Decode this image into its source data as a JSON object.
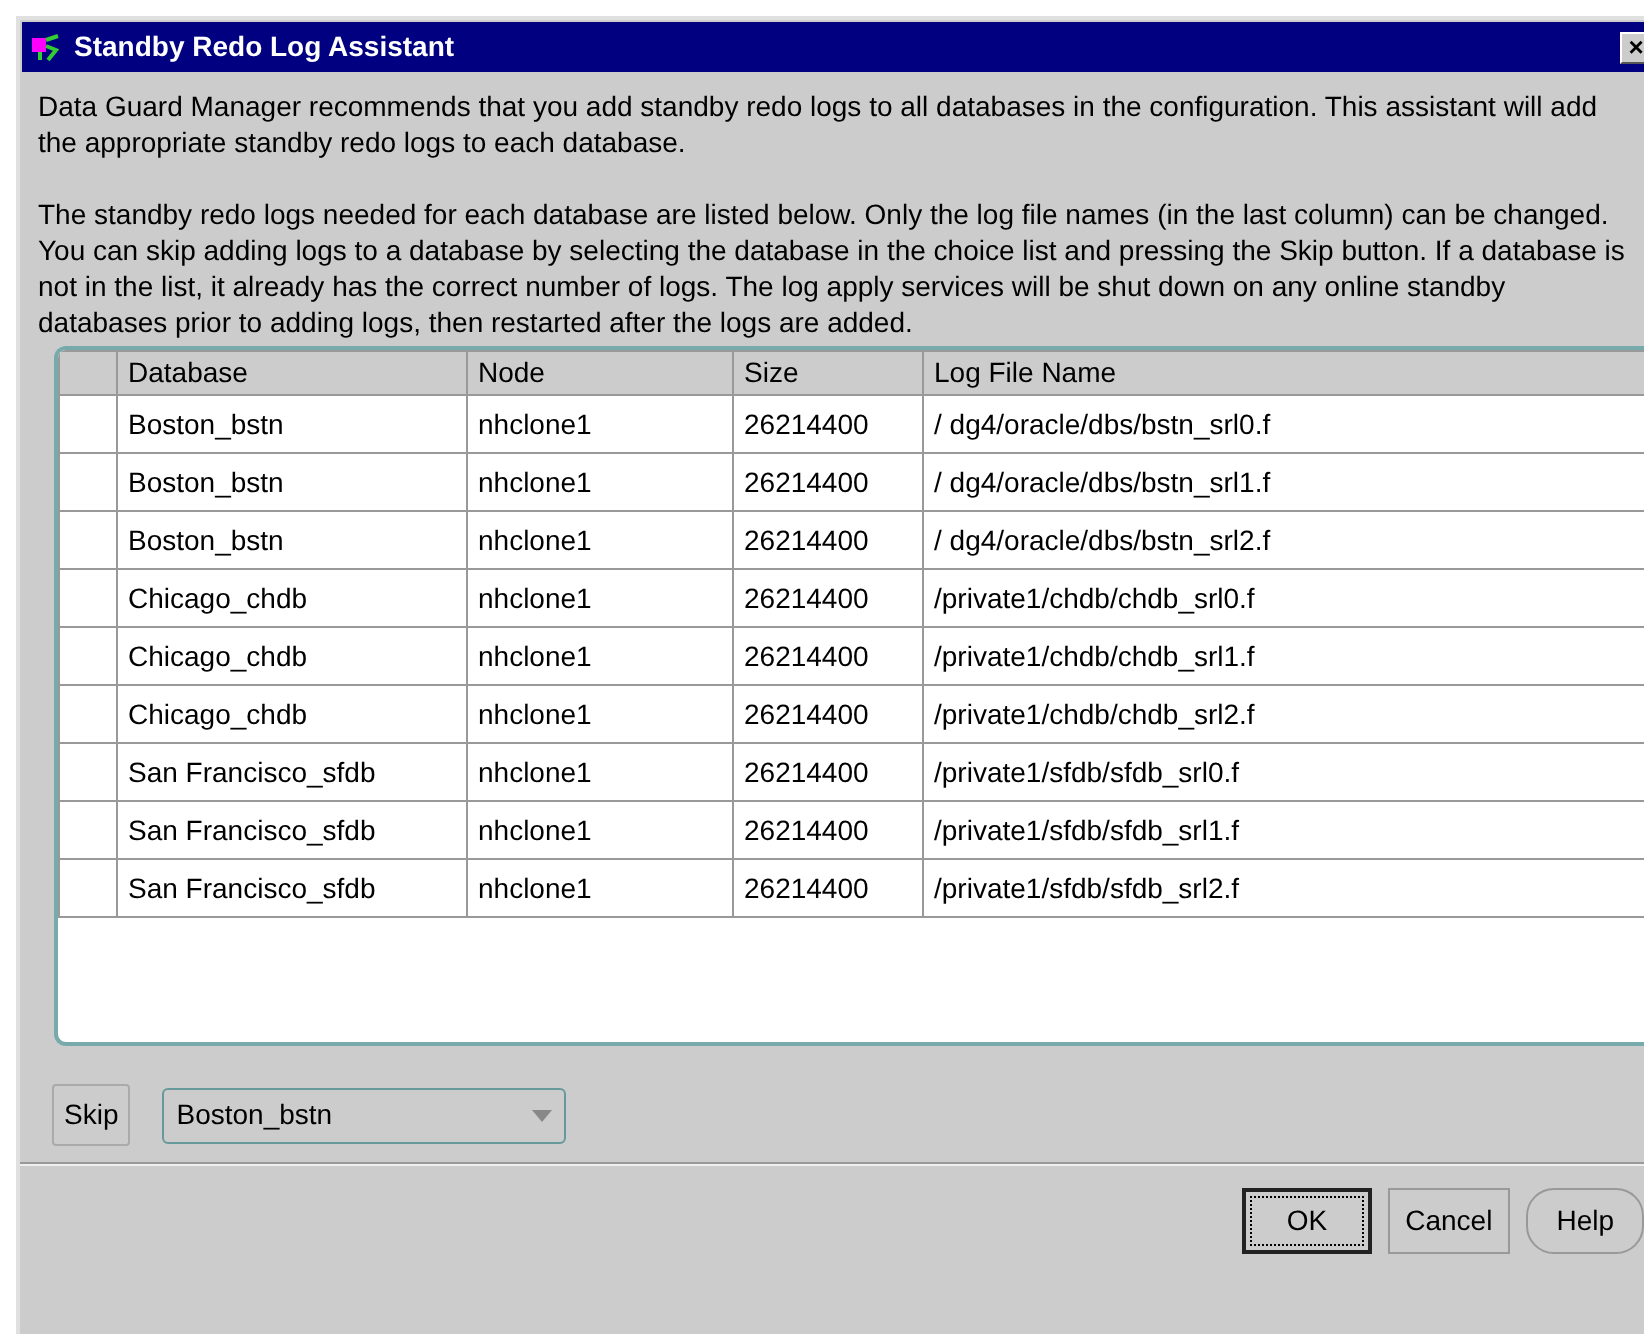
{
  "window": {
    "title": "Standby Redo Log Assistant",
    "close": "×"
  },
  "paragraphs": [
    "Data Guard Manager recommends that you add standby redo logs to all databases in the configuration. This assistant will add the appropriate standby redo logs to each database.",
    "The standby redo logs needed for each database are listed below. Only the log file names (in the last column) can be changed. You can skip adding logs to a database by selecting the database in the choice list and pressing the Skip button. If a database is not in the list, it already has the correct number of logs. The log apply services will be shut down on any online standby databases prior to adding logs, then restarted after the logs are added."
  ],
  "table": {
    "columns": [
      "Database",
      "Node",
      "Size",
      "Log File Name"
    ],
    "rows": [
      [
        "Boston_bstn",
        "nhclone1",
        "26214400",
        "/ dg4/oracle/dbs/bstn_srl0.f"
      ],
      [
        "Boston_bstn",
        "nhclone1",
        "26214400",
        "/ dg4/oracle/dbs/bstn_srl1.f"
      ],
      [
        "Boston_bstn",
        "nhclone1",
        "26214400",
        "/ dg4/oracle/dbs/bstn_srl2.f"
      ],
      [
        "Chicago_chdb",
        "nhclone1",
        "26214400",
        "/private1/chdb/chdb_srl0.f"
      ],
      [
        "Chicago_chdb",
        "nhclone1",
        "26214400",
        "/private1/chdb/chdb_srl1.f"
      ],
      [
        "Chicago_chdb",
        "nhclone1",
        "26214400",
        "/private1/chdb/chdb_srl2.f"
      ],
      [
        "San Francisco_sfdb",
        "nhclone1",
        "26214400",
        "/private1/sfdb/sfdb_srl0.f"
      ],
      [
        "San Francisco_sfdb",
        "nhclone1",
        "26214400",
        "/private1/sfdb/sfdb_srl1.f"
      ],
      [
        "San Francisco_sfdb",
        "nhclone1",
        "26214400",
        "/private1/sfdb/sfdb_srl2.f"
      ]
    ]
  },
  "skip_button": "Skip",
  "database_choice": {
    "value": "Boston_bstn"
  },
  "buttons": [
    {
      "label": "OK",
      "kind": "default"
    },
    {
      "label": "Cancel",
      "kind": "plain"
    },
    {
      "label": "Help",
      "kind": "rounded"
    }
  ]
}
